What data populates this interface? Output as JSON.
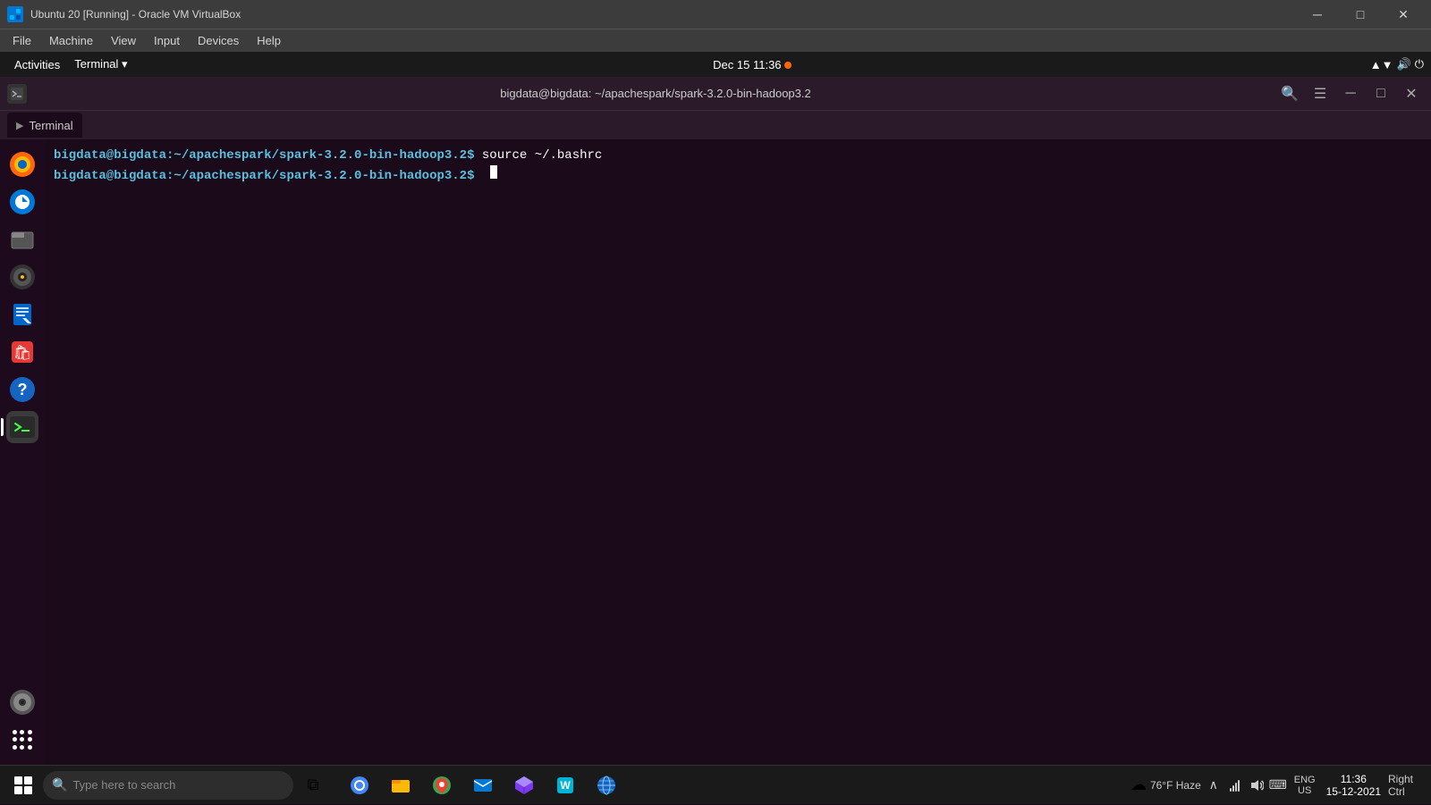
{
  "vbox": {
    "titlebar": {
      "text": "Ubuntu 20 [Running] - Oracle VM VirtualBox",
      "icon": "VB"
    },
    "window_controls": {
      "minimize": "─",
      "maximize": "□",
      "close": "✕"
    },
    "menu": {
      "items": [
        "File",
        "Machine",
        "View",
        "Input",
        "Devices",
        "Help"
      ]
    },
    "capture_bar": {
      "text": "Right Ctrl"
    }
  },
  "ubuntu": {
    "topbar": {
      "activities": "Activities",
      "terminal_menu": "Terminal ▾",
      "clock": "Dec 15  11:36",
      "dot": true
    },
    "terminal": {
      "title": "bigdata@bigdata: ~/apachespark/spark-3.2.0-bin-hadoop3.2",
      "tab_label": "Terminal",
      "line1_prompt": "bigdata@bigdata:~/apachespark/spark-3.2.0-bin-hadoop3.2$",
      "line1_cmd": " source ~/.bashrc",
      "line2_prompt": "bigdata@bigdata:~/apachespark/spark-3.2.0-bin-hadoop3.2$"
    }
  },
  "dock": {
    "items": [
      {
        "name": "Firefox",
        "icon": "🦊",
        "active": false
      },
      {
        "name": "Thunderbird",
        "icon": "🐦",
        "active": false
      },
      {
        "name": "Files",
        "icon": "📁",
        "active": false
      },
      {
        "name": "Rhythmbox",
        "icon": "🎵",
        "active": false
      },
      {
        "name": "Writer",
        "icon": "📄",
        "active": false
      },
      {
        "name": "Software",
        "icon": "🛍",
        "active": false
      },
      {
        "name": "Help",
        "icon": "❓",
        "active": false
      },
      {
        "name": "Terminal",
        "icon": ">_",
        "active": true
      },
      {
        "name": "Optical",
        "icon": "💿",
        "active": false
      }
    ]
  },
  "windows_taskbar": {
    "search_placeholder": "Type here to search",
    "apps": [
      "⊞",
      "🌐",
      "📁",
      "🔴",
      "⊞",
      "⬡",
      "⊞",
      "🌐",
      "⊞"
    ],
    "weather": "76°F Haze",
    "clock": {
      "time": "11:36",
      "date": "15-12-2021"
    },
    "lang": {
      "code": "ENG",
      "region": "US"
    },
    "notification": "Right Ctrl"
  }
}
